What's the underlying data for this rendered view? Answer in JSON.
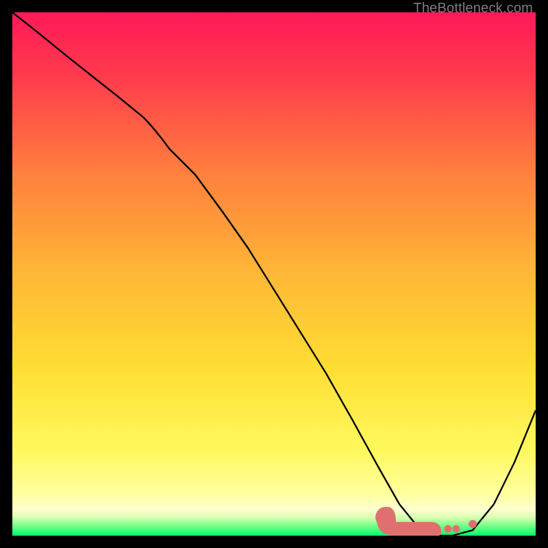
{
  "watermark": "TheBottleneck.com",
  "chart_data": {
    "type": "line",
    "title": "",
    "xlabel": "",
    "ylabel": "",
    "xlim": [
      0,
      100
    ],
    "ylim": [
      0,
      100
    ],
    "grid": false,
    "series": [
      {
        "name": "curve",
        "x": [
          0,
          5,
          10,
          15,
          20,
          25,
          30,
          35,
          40,
          45,
          50,
          55,
          60,
          65,
          70,
          74,
          78,
          80,
          84,
          88,
          92,
          96,
          100
        ],
        "y": [
          100,
          96,
          92,
          88,
          84,
          80,
          75,
          69,
          62,
          55,
          47,
          39,
          31,
          22,
          13,
          6,
          1,
          0,
          0,
          1,
          6,
          14,
          24
        ]
      },
      {
        "name": "marker-band",
        "x": [
          70,
          72,
          74,
          76,
          78,
          80,
          82,
          84
        ],
        "y": [
          3,
          2.2,
          1.8,
          1.6,
          1.6,
          1.6,
          1.8,
          2.0
        ]
      },
      {
        "name": "marker-dot",
        "x": [
          87
        ],
        "y": [
          2.2
        ]
      }
    ],
    "legend": false,
    "background_gradient": {
      "top": "#ff1a58",
      "mid": "#ffd233",
      "bottom_band": "#ffffbd",
      "base": "#00ff66"
    }
  }
}
